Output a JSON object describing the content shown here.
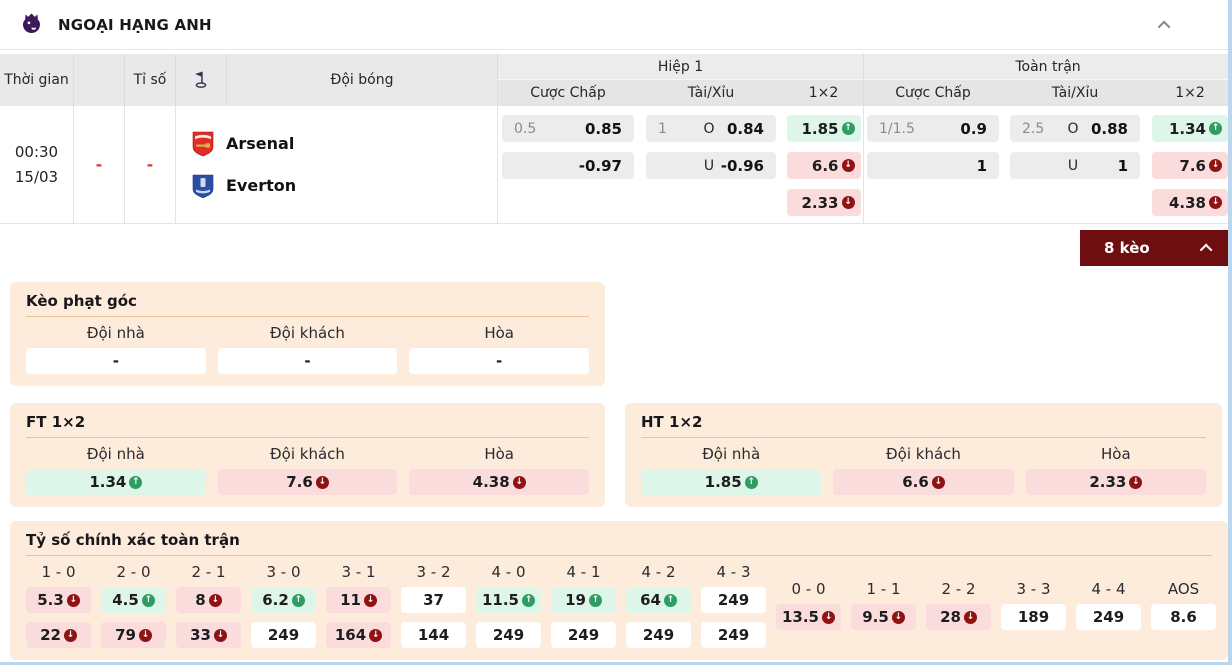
{
  "colors": {
    "brand_purple": "#3d195b",
    "up_green": "#2f9d63",
    "down_red": "#8f1313",
    "odds_up_bg": "#def5e9",
    "odds_down_bg": "#fbdcdc",
    "panel_bg": "#fdecdb",
    "keo_bar_bg": "#6e0e10",
    "dash_red": "#e03a2f"
  },
  "league_header": {
    "title": "NGOẠI HẠNG ANH"
  },
  "odds_table": {
    "headers": {
      "time": "Thời gian",
      "score": "Tỉ số",
      "team": "Đội bóng",
      "half1": "Hiệp 1",
      "fulltime": "Toàn trận",
      "handicap": "Cược Chấp",
      "over_under": "Tài/Xỉu",
      "one_x_two": "1×2"
    },
    "match": {
      "time": "00:30",
      "date": "15/03",
      "score_home": "-",
      "score_away": "-",
      "home": "Arsenal",
      "away": "Everton",
      "h1_handicap": {
        "line": "0.5",
        "top": "0.85",
        "bottom": "-0.97"
      },
      "h1_ou": {
        "line": "1",
        "over_label": "O",
        "over": "0.84",
        "under_label": "U",
        "under": "-0.96"
      },
      "h1_1x2": {
        "home": {
          "value": "1.85",
          "trend": "up"
        },
        "away": {
          "value": "6.6",
          "trend": "down"
        },
        "draw": {
          "value": "2.33",
          "trend": "down"
        }
      },
      "ft_handicap": {
        "line": "1/1.5",
        "top": "0.9",
        "bottom": "1"
      },
      "ft_ou": {
        "line": "2.5",
        "over_label": "O",
        "over": "0.88",
        "under_label": "U",
        "under": "1"
      },
      "ft_1x2": {
        "home": {
          "value": "1.34",
          "trend": "up"
        },
        "away": {
          "value": "7.6",
          "trend": "down"
        },
        "draw": {
          "value": "4.38",
          "trend": "down"
        }
      }
    }
  },
  "keo_bar": {
    "label": "8 kèo"
  },
  "corner_panel": {
    "title": "Kèo phạt góc",
    "headers": [
      "Đội nhà",
      "Đội khách",
      "Hòa"
    ],
    "values": [
      "-",
      "-",
      "-"
    ]
  },
  "ft_panel": {
    "title": "FT 1×2",
    "headers": [
      "Đội nhà",
      "Đội khách",
      "Hòa"
    ],
    "cells": [
      {
        "value": "1.34",
        "trend": "up"
      },
      {
        "value": "7.6",
        "trend": "down"
      },
      {
        "value": "4.38",
        "trend": "down"
      }
    ]
  },
  "ht_panel": {
    "title": "HT 1×2",
    "headers": [
      "Đội nhà",
      "Đội khách",
      "Hòa"
    ],
    "cells": [
      {
        "value": "1.85",
        "trend": "up"
      },
      {
        "value": "6.6",
        "trend": "down"
      },
      {
        "value": "2.33",
        "trend": "down"
      }
    ]
  },
  "score_panel": {
    "title": "Tỷ số chính xác toàn trận",
    "left": [
      {
        "label": "1 - 0",
        "r1": {
          "value": "5.3",
          "trend": "down"
        },
        "r2": {
          "value": "22",
          "trend": "down"
        }
      },
      {
        "label": "2 - 0",
        "r1": {
          "value": "4.5",
          "trend": "up"
        },
        "r2": {
          "value": "79",
          "trend": "down"
        }
      },
      {
        "label": "2 - 1",
        "r1": {
          "value": "8",
          "trend": "down"
        },
        "r2": {
          "value": "33",
          "trend": "down"
        }
      },
      {
        "label": "3 - 0",
        "r1": {
          "value": "6.2",
          "trend": "up"
        },
        "r2": {
          "value": "249",
          "trend": "none"
        }
      },
      {
        "label": "3 - 1",
        "r1": {
          "value": "11",
          "trend": "down"
        },
        "r2": {
          "value": "164",
          "trend": "down"
        }
      },
      {
        "label": "3 - 2",
        "r1": {
          "value": "37",
          "trend": "none"
        },
        "r2": {
          "value": "144",
          "trend": "none"
        }
      },
      {
        "label": "4 - 0",
        "r1": {
          "value": "11.5",
          "trend": "up"
        },
        "r2": {
          "value": "249",
          "trend": "none"
        }
      },
      {
        "label": "4 - 1",
        "r1": {
          "value": "19",
          "trend": "up"
        },
        "r2": {
          "value": "249",
          "trend": "none"
        }
      },
      {
        "label": "4 - 2",
        "r1": {
          "value": "64",
          "trend": "up"
        },
        "r2": {
          "value": "249",
          "trend": "none"
        }
      },
      {
        "label": "4 - 3",
        "r1": {
          "value": "249",
          "trend": "none"
        },
        "r2": {
          "value": "249",
          "trend": "none"
        }
      }
    ],
    "right": [
      {
        "label": "0 - 0",
        "r1": {
          "value": "13.5",
          "trend": "down"
        }
      },
      {
        "label": "1 - 1",
        "r1": {
          "value": "9.5",
          "trend": "down"
        }
      },
      {
        "label": "2 - 2",
        "r1": {
          "value": "28",
          "trend": "down"
        }
      },
      {
        "label": "3 - 3",
        "r1": {
          "value": "189",
          "trend": "none"
        }
      },
      {
        "label": "4 - 4",
        "r1": {
          "value": "249",
          "trend": "none"
        }
      },
      {
        "label": "AOS",
        "r1": {
          "value": "8.6",
          "trend": "none"
        }
      }
    ]
  }
}
